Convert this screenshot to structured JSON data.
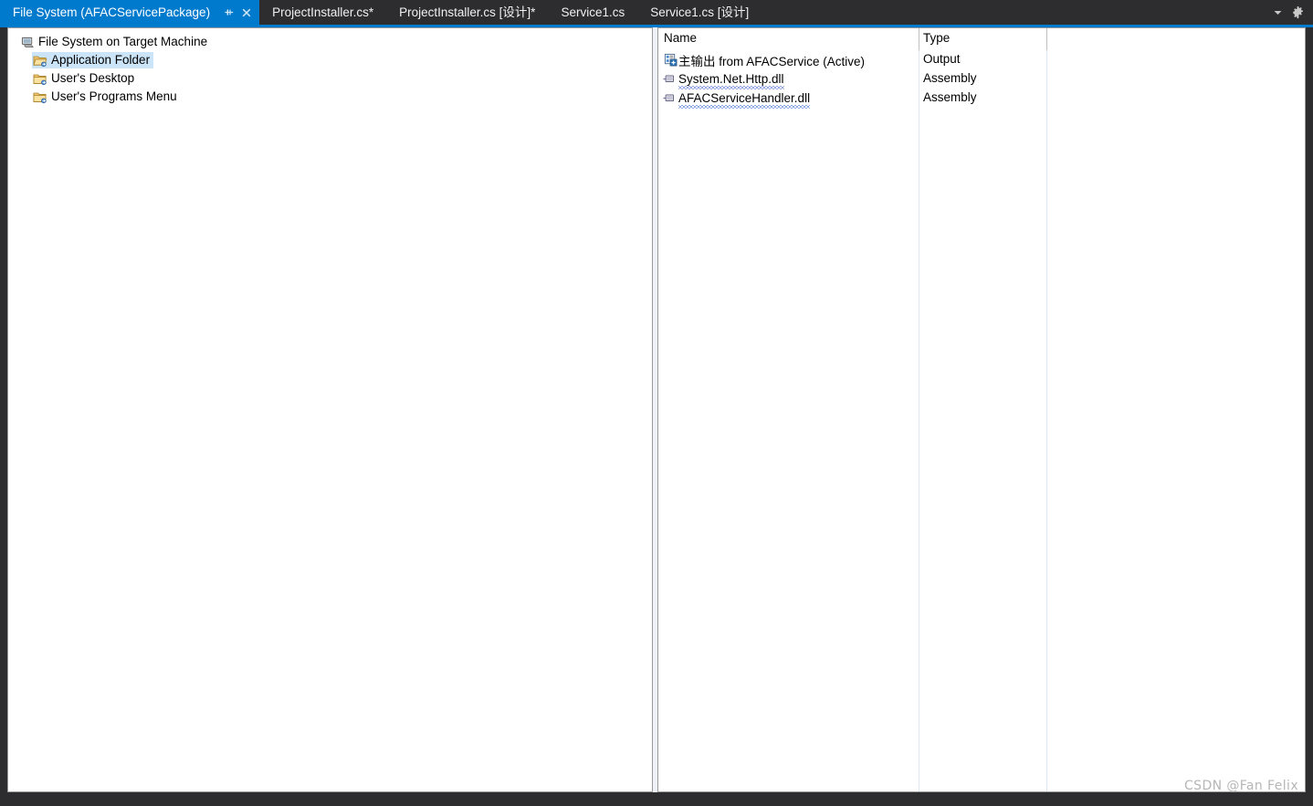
{
  "window": {
    "background_color": "#2D2D30",
    "accent_color": "#007ACC"
  },
  "tabstrip": {
    "tabs": [
      {
        "label": "File System (AFACServicePackage)",
        "active": true,
        "modified": false
      },
      {
        "label": "ProjectInstaller.cs*",
        "active": false,
        "modified": true
      },
      {
        "label": "ProjectInstaller.cs [设计]*",
        "active": false,
        "modified": true
      },
      {
        "label": "Service1.cs",
        "active": false,
        "modified": false
      },
      {
        "label": "Service1.cs [设计]",
        "active": false,
        "modified": false
      }
    ],
    "active_tab_pin_icon": "pin-icon",
    "active_tab_close_icon": "close-icon",
    "overflow_icon": "chevron-down-icon",
    "options_icon": "gear-icon"
  },
  "file_system_tree": {
    "root": {
      "label": "File System on Target Machine",
      "icon": "computer-icon"
    },
    "items": [
      {
        "label": "Application Folder",
        "icon": "folder-open-icon",
        "selected": true
      },
      {
        "label": "User's Desktop",
        "icon": "folder-icon",
        "selected": false
      },
      {
        "label": "User's Programs Menu",
        "icon": "folder-icon",
        "selected": false
      }
    ]
  },
  "file_list": {
    "columns": [
      {
        "label": "Name"
      },
      {
        "label": "Type"
      }
    ],
    "rows": [
      {
        "name": "主输出 from AFACService (Active)",
        "type": "Output",
        "icon": "project-output-icon",
        "squiggly": false
      },
      {
        "name": "System.Net.Http.dll",
        "type": "Assembly",
        "icon": "assembly-icon",
        "squiggly": true
      },
      {
        "name": "AFACServiceHandler.dll",
        "type": "Assembly",
        "icon": "assembly-icon",
        "squiggly": true
      }
    ]
  },
  "watermark": {
    "text": "CSDN @Fan Felix"
  }
}
